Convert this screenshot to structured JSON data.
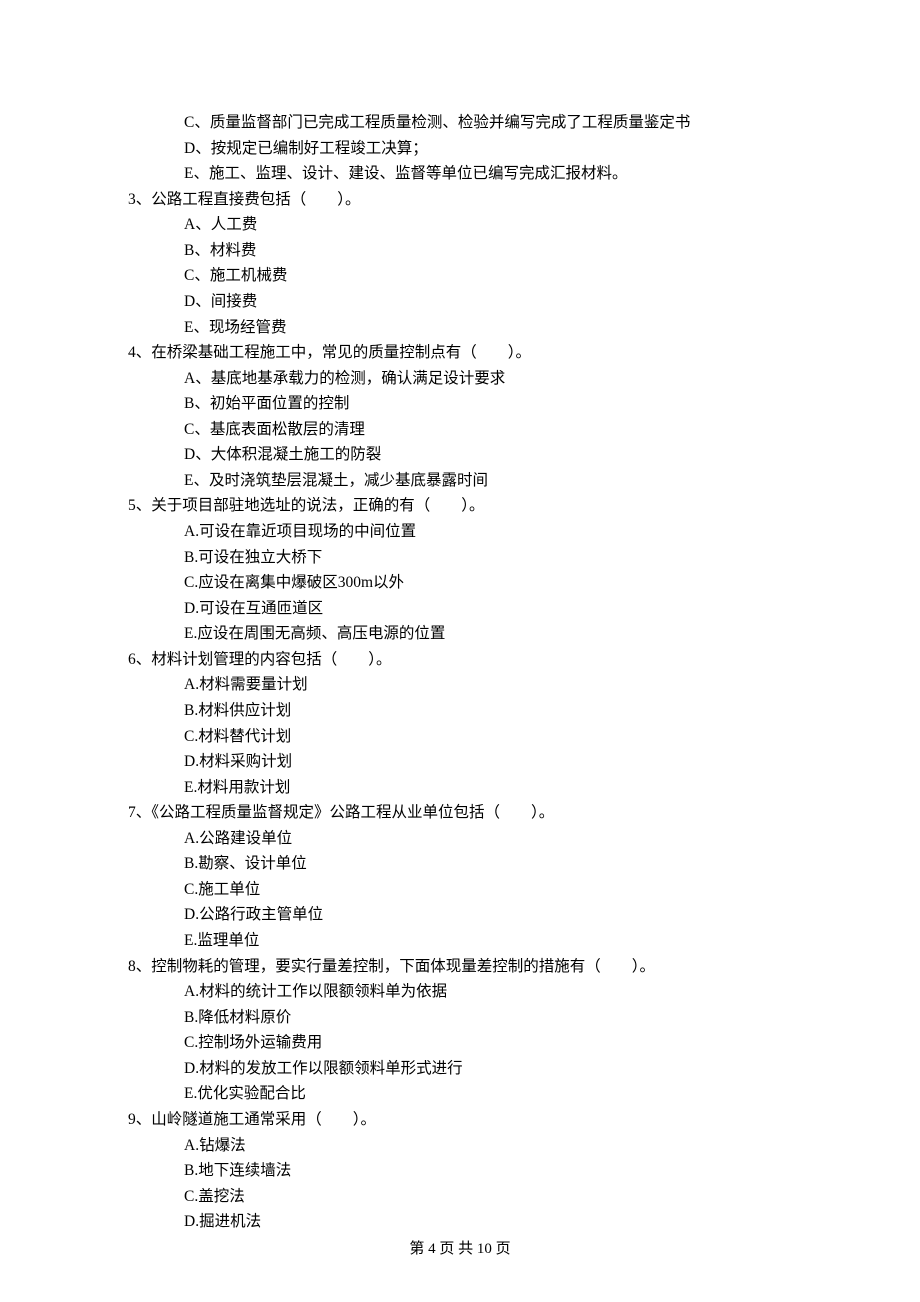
{
  "orphan_options": [
    "C、质量监督部门已完成工程质量检测、检验并编写完成了工程质量鉴定书",
    "D、按规定已编制好工程竣工决算；",
    "E、施工、监理、设计、建设、监督等单位已编写完成汇报材料。"
  ],
  "questions": [
    {
      "stem": "3、公路工程直接费包括（　　）。",
      "options": [
        "A、人工费",
        "B、材料费",
        "C、施工机械费",
        "D、间接费",
        "E、现场经管费"
      ]
    },
    {
      "stem": "4、在桥梁基础工程施工中，常见的质量控制点有（　　）。",
      "options": [
        "A、基底地基承载力的检测，确认满足设计要求",
        "B、初始平面位置的控制",
        "C、基底表面松散层的清理",
        "D、大体积混凝土施工的防裂",
        "E、及时浇筑垫层混凝土，减少基底暴露时间"
      ]
    },
    {
      "stem": "5、关于项目部驻地选址的说法，正确的有（　　）。",
      "options": [
        "A.可设在靠近项目现场的中间位置",
        "B.可设在独立大桥下",
        "C.应设在离集中爆破区300m以外",
        "D.可设在互通匝道区",
        "E.应设在周围无高频、高压电源的位置"
      ]
    },
    {
      "stem": "6、材料计划管理的内容包括（　　）。",
      "options": [
        "A.材料需要量计划",
        "B.材料供应计划",
        "C.材料替代计划",
        "D.材料采购计划",
        "E.材料用款计划"
      ]
    },
    {
      "stem": "7、《公路工程质量监督规定》公路工程从业单位包括（　　）。",
      "options": [
        "A.公路建设单位",
        "B.勘察、设计单位",
        "C.施工单位",
        "D.公路行政主管单位",
        "E.监理单位"
      ]
    },
    {
      "stem": "8、控制物耗的管理，要实行量差控制，下面体现量差控制的措施有（　　）。",
      "options": [
        "A.材料的统计工作以限额领料单为依据",
        "B.降低材料原价",
        "C.控制场外运输费用",
        "D.材料的发放工作以限额领料单形式进行",
        "E.优化实验配合比"
      ]
    },
    {
      "stem": "9、山岭隧道施工通常采用（　　）。",
      "options": [
        "A.钻爆法",
        "B.地下连续墙法",
        "C.盖挖法",
        "D.掘进机法"
      ]
    }
  ],
  "footer": "第 4 页 共 10 页"
}
